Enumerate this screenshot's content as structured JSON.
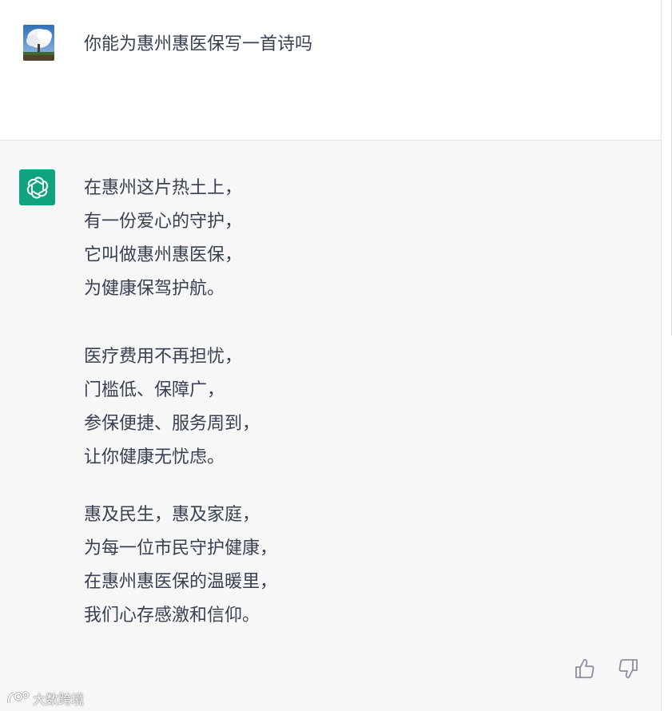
{
  "conversation": {
    "user_message": "你能为惠州惠医保写一首诗吗",
    "assistant_poem": {
      "stanzas": [
        [
          "在惠州这片热土上，",
          "有一份爱心的守护，",
          "它叫做惠州惠医保，",
          "为健康保驾护航。"
        ],
        [
          "医疗费用不再担忧，",
          "门槛低、保障广，",
          "参保便捷、服务周到，",
          "让你健康无忧虑。"
        ],
        [
          "惠及民生，惠及家庭，",
          "为每一位市民守护健康，",
          "在惠州惠医保的温暖里，",
          "我们心存感激和信仰。"
        ]
      ]
    }
  },
  "feedback": {
    "thumbs_up_icon": "thumbs-up-icon",
    "thumbs_down_icon": "thumbs-down-icon"
  },
  "watermark": {
    "text": "大数跨境"
  },
  "colors": {
    "assistant_bg": "#f7f7f8",
    "logo_bg": "#10a37f",
    "text": "#374151",
    "icon": "#8e8ea0"
  }
}
